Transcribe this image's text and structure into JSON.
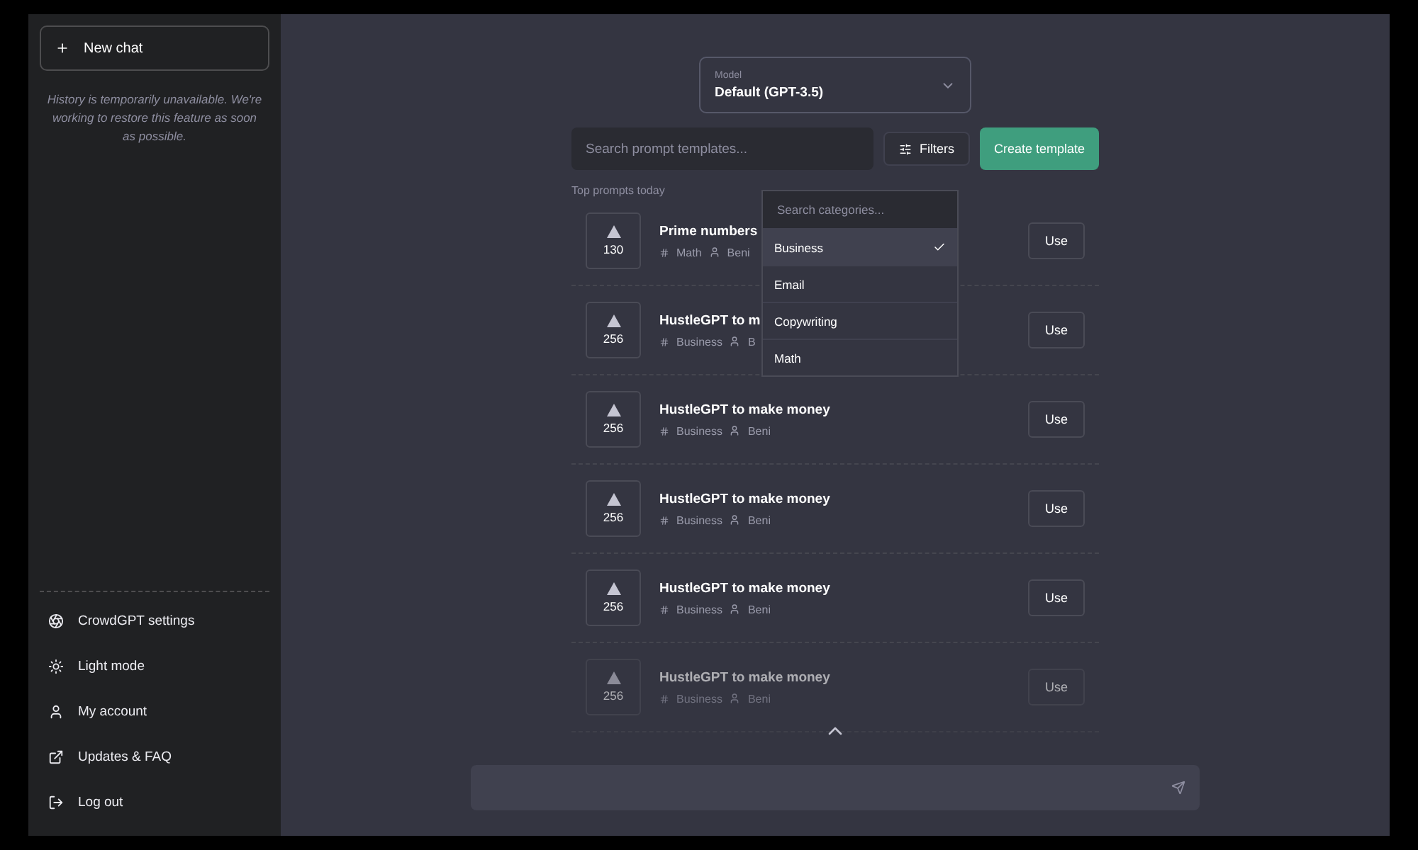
{
  "sidebar": {
    "new_chat": "New chat",
    "history_notice": "History is temporarily unavailable. We're working to restore this feature as soon as possible.",
    "menu": [
      {
        "kind": "settings",
        "label": "CrowdGPT settings"
      },
      {
        "kind": "light",
        "label": "Light mode"
      },
      {
        "kind": "account",
        "label": "My account"
      },
      {
        "kind": "updates",
        "label": "Updates & FAQ"
      },
      {
        "kind": "logout",
        "label": "Log out"
      }
    ]
  },
  "model": {
    "label": "Model",
    "value": "Default (GPT-3.5)"
  },
  "search": {
    "placeholder": "Search prompt templates..."
  },
  "filters_button": "Filters",
  "create_button": "Create template",
  "section_title": "Top prompts today",
  "prompts": [
    {
      "votes": "130",
      "title": "Prime numbers",
      "tag": "Math",
      "author": "Beni",
      "use": "Use",
      "faded": false
    },
    {
      "votes": "256",
      "title": "HustleGPT to m",
      "tag": "Business",
      "author": "B",
      "use": "Use",
      "faded": false
    },
    {
      "votes": "256",
      "title": "HustleGPT to make money",
      "tag": "Business",
      "author": "Beni",
      "use": "Use",
      "faded": false
    },
    {
      "votes": "256",
      "title": "HustleGPT to make money",
      "tag": "Business",
      "author": "Beni",
      "use": "Use",
      "faded": false
    },
    {
      "votes": "256",
      "title": "HustleGPT to make money",
      "tag": "Business",
      "author": "Beni",
      "use": "Use",
      "faded": false
    },
    {
      "votes": "256",
      "title": "HustleGPT to make money",
      "tag": "Business",
      "author": "Beni",
      "use": "Use",
      "faded": true
    }
  ],
  "category_dropdown": {
    "placeholder": "Search categories...",
    "options": [
      {
        "label": "Business",
        "selected": true
      },
      {
        "label": "Email",
        "selected": false
      },
      {
        "label": "Copywriting",
        "selected": false
      },
      {
        "label": "Math",
        "selected": false
      }
    ]
  }
}
